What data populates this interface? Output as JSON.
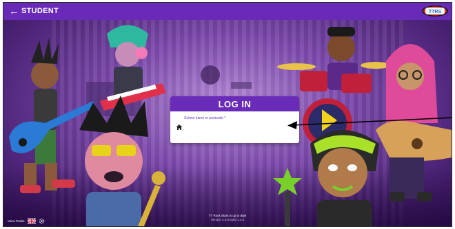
{
  "header": {
    "back_label": "STUDENT",
    "logo_text": "TT ROCK"
  },
  "login": {
    "title": "LOG IN",
    "field_label": "School name or postcode *",
    "field_value": "",
    "field_placeholder": ""
  },
  "footer": {
    "voice_label": "Voice Packs",
    "notice_line1": "TT Rock Stars is up to date",
    "notice_line2": "Version 4.0.0 build 1.4.0"
  },
  "colors": {
    "brand_purple": "#6a2ab8",
    "card_header": "#6b2bb9",
    "annotation": "#000000"
  },
  "icons": [
    "back-arrow-icon",
    "tt-rock-stars-logo",
    "home-icon",
    "uk-flag-icon",
    "gear-icon"
  ]
}
